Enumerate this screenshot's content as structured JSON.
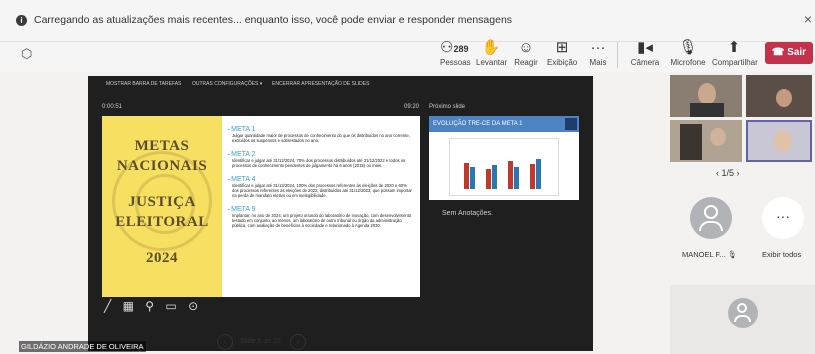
{
  "banner": {
    "message": "Carregando as atualizações mais recentes... enquanto isso, você pode enviar e responder mensagens",
    "close": "×"
  },
  "toolbar": {
    "people_count": "289",
    "people_label": "Pessoas",
    "raise_label": "Levantar",
    "react_label": "Reagir",
    "view_label": "Exibição",
    "more_label": "Mais",
    "camera_label": "Câmera",
    "mic_label": "Microfone",
    "share_label": "Compartilhar",
    "leave_label": "Sair"
  },
  "presenter": {
    "controls": [
      "MOSTRAR BARRA DE TAREFAS",
      "OUTRAS CONFIGURAÇÕES ▾",
      "ENCERRAR APRESENTAÇÃO DE SLIDES"
    ],
    "timer": "0:00:51",
    "clock": "09:20",
    "next_slide_label": "Próximo slide",
    "next_slide_title": "EVOLUÇÃO TRE-CE DA META 1",
    "notes": "Sem Anotações.",
    "slide_counter": "Slide 5 de 22",
    "presenter_name": "GILDÁZIO ANDRADE DE OLIVEIRA"
  },
  "slide": {
    "title_lines": [
      "METAS",
      "NACIONAIS",
      "JUSTIÇA",
      "ELEITORAL",
      "2024"
    ],
    "metas": [
      {
        "title": "META 1",
        "text": "Julgar quantidade maior de processos de conhecimento do que os distribuídos no ano corrente, excluídos os suspensos e sobrestados no ano."
      },
      {
        "title": "META 2",
        "text": "Identificar e julgar até 31/12/2024, 70% dos processos distribuídos até 31/12/2022 e todos os processos de conhecimento pendentes de julgamento há 6 anos (2018) ou mais."
      },
      {
        "title": "META 4",
        "text": "Identificar e julgar até 31/12/2024, 100% dos processos referentes às eleições de 2020 e 60% dos processos referentes às eleições de 2022, distribuídos até 31/12/2023, que possam importar na perda de mandato eletivo ou em inelegibilidade."
      },
      {
        "title": "META 9",
        "text": "Implantar, no ano de 2024, um projeto oriundo do laboratório de inovação, com desenvolvimento testado em conjunto, ao menos, um laboratório de outro tribunal ou órgão da administração pública, com avaliação de benefícios à sociedade e relacionado à Agenda 2030."
      }
    ]
  },
  "participants": {
    "page_indicator": "1/5",
    "p1_name": "MANOEL F...",
    "p2_label": "Exibir todos"
  },
  "colors": {
    "leave": "#c4314b",
    "accent": "#3fa0d4",
    "slide_bg": "#f7df62"
  }
}
